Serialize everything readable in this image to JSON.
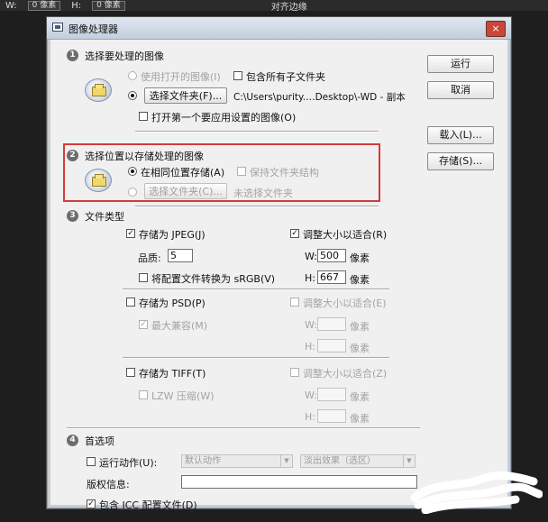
{
  "topbar": {
    "items": [
      "W:",
      "0 像素",
      "H:",
      "0 像素",
      "对齐边缘"
    ]
  },
  "window": {
    "title": "图像处理器",
    "close": "×"
  },
  "section1": {
    "number": "1",
    "title": "选择要处理的图像",
    "use_open_images": "使用打开的图像(I)",
    "include_subfolders": "包含所有子文件夹",
    "select_folder_button": "选择文件夹(F)...",
    "folder_path": "C:\\Users\\purity.…Desktop\\-WD - 副本",
    "open_first_image": "打开第一个要应用设置的图像(O)"
  },
  "section2": {
    "number": "2",
    "title": "选择位置以存储处理的图像",
    "save_same_location": "在相同位置存储(A)",
    "keep_folder_structure": "保持文件夹结构",
    "select_folder_button": "选择文件夹(C)...",
    "no_folder_selected": "未选择文件夹"
  },
  "section3": {
    "number": "3",
    "title": "文件类型",
    "jpeg": {
      "save_as": "存储为 JPEG(J)",
      "resize": "调整大小以适合(R)",
      "quality_label": "品质:",
      "quality_value": "5",
      "w_label": "W:",
      "w_value": "500",
      "w_unit": "像素",
      "h_label": "H:",
      "h_value": "667",
      "h_unit": "像素",
      "convert_srgb": "将配置文件转换为 sRGB(V)"
    },
    "psd": {
      "save_as": "存储为 PSD(P)",
      "resize": "调整大小以适合(E)",
      "maximize": "最大兼容(M)",
      "w_label": "W:",
      "w_unit": "像素",
      "h_label": "H:",
      "h_unit": "像素"
    },
    "tiff": {
      "save_as": "存储为 TIFF(T)",
      "resize": "调整大小以适合(Z)",
      "lzw": "LZW 压缩(W)",
      "w_label": "W:",
      "w_unit": "像素",
      "h_label": "H:",
      "h_unit": "像素"
    }
  },
  "section4": {
    "number": "4",
    "title": "首选项",
    "run_action": "运行动作(U):",
    "action_set": "默认动作",
    "action": "淡出效果（选区）",
    "copyright_label": "版权信息:",
    "copyright_value": "",
    "include_icc": "包含 ICC 配置文件(D)"
  },
  "buttons": {
    "run": "运行",
    "cancel": "取消",
    "load": "载入(L)...",
    "save": "存储(S)..."
  },
  "colors": {
    "highlight_box": "#d43a3a",
    "dialog_bg": "#f0f0f0"
  }
}
